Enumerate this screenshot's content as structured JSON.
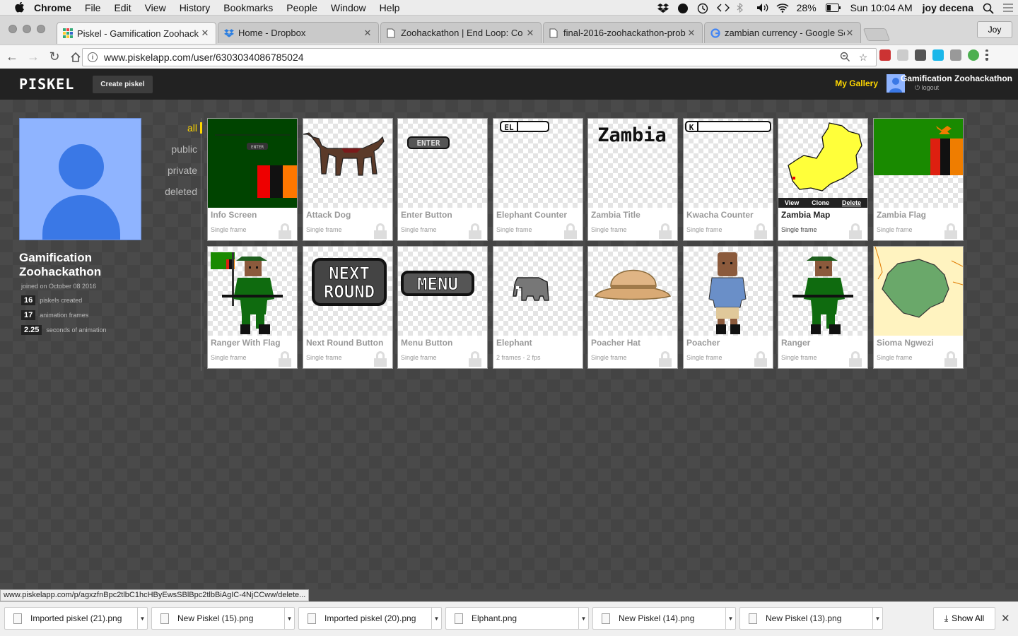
{
  "menubar": {
    "app": "Chrome",
    "items": [
      "File",
      "Edit",
      "View",
      "History",
      "Bookmarks",
      "People",
      "Window",
      "Help"
    ],
    "battery": "28%",
    "clock": "Sun 10:04 AM",
    "user": "joy decena"
  },
  "tabs": [
    {
      "title": "Piskel - Gamification Zoohack",
      "icon": "piskel-grid-icon",
      "active": true
    },
    {
      "title": "Home - Dropbox",
      "icon": "dropbox-icon",
      "active": false
    },
    {
      "title": "Zoohackathon | End Loop: Co",
      "icon": "page-icon",
      "active": false
    },
    {
      "title": "final-2016-zoohackathon-prob",
      "icon": "page-icon",
      "active": false
    },
    {
      "title": "zambian currency - Google Se",
      "icon": "google-icon",
      "active": false
    }
  ],
  "profile_button": "Joy",
  "address": {
    "url": "www.piskelapp.com/user/6303034086785024"
  },
  "piskel": {
    "logo": "PISKEL",
    "create": "Create piskel",
    "my_gallery": "My Gallery",
    "user_name": "Gamification Zoohackathon",
    "logout": "logout"
  },
  "user": {
    "name": "Gamification Zoohackathon",
    "joined": "joined on October 08 2016",
    "stats": [
      {
        "num": "16",
        "label": "piskels created"
      },
      {
        "num": "17",
        "label": "animation frames"
      },
      {
        "num": "2.25",
        "label": "seconds of animation"
      }
    ]
  },
  "filters": [
    "all",
    "public",
    "private",
    "deleted"
  ],
  "hover_actions": [
    "View",
    "Clone",
    "Delete"
  ],
  "sprites": [
    {
      "title": "Info Screen",
      "sub": "Single frame"
    },
    {
      "title": "Attack Dog",
      "sub": "Single frame"
    },
    {
      "title": "Enter Button",
      "sub": "Single frame"
    },
    {
      "title": "Elephant Counter",
      "sub": "Single frame"
    },
    {
      "title": "Zambia Title",
      "sub": "Single frame"
    },
    {
      "title": "Kwacha Counter",
      "sub": "Single frame"
    },
    {
      "title": "Zambia Map",
      "sub": "Single frame"
    },
    {
      "title": "Zambia Flag",
      "sub": "Single frame"
    },
    {
      "title": "Ranger With Flag",
      "sub": "Single frame"
    },
    {
      "title": "Next Round Button",
      "sub": "Single frame"
    },
    {
      "title": "Menu Button",
      "sub": "Single frame"
    },
    {
      "title": "Elephant",
      "sub": "2 frames - 2 fps"
    },
    {
      "title": "Poacher Hat",
      "sub": "Single frame"
    },
    {
      "title": "Poacher",
      "sub": "Single frame"
    },
    {
      "title": "Ranger",
      "sub": "Single frame"
    },
    {
      "title": "Sioma Ngwezi",
      "sub": "Single frame"
    }
  ],
  "art_text": {
    "enter": "ENTER",
    "el": "EL",
    "zambia": "Zambia",
    "k": "K",
    "next": "NEXT",
    "round": "ROUND",
    "menu": "MENU"
  },
  "status_url": "www.piskelapp.com/p/agxzfnBpc2tlbC1hcHByEwsSBlBpc2tlbBiAgIC-4NjCCww/delete...",
  "downloads": [
    "Imported piskel (21).png",
    "New Piskel (15).png",
    "Imported piskel (20).png",
    "Elphant.png",
    "New Piskel (14).png",
    "New Piskel (13).png"
  ],
  "show_all": "Show All"
}
